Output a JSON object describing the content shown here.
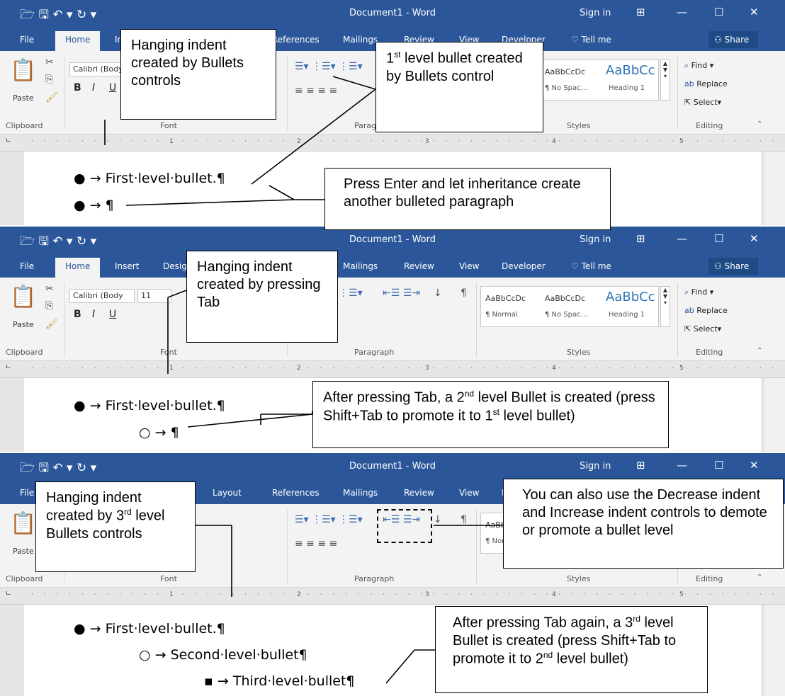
{
  "app": {
    "title": "Document1 - Word",
    "sign_in": "Sign in",
    "win_minimize": "—",
    "win_maximize": "☐",
    "win_close": "✕",
    "qat_glyphs": "🗁 🖫 ↶ ▾ ↻ ▾",
    "tabs": [
      {
        "label": "File"
      },
      {
        "label": "Home"
      },
      {
        "label": "Insert"
      },
      {
        "label": "Design"
      },
      {
        "label": "Layout"
      },
      {
        "label": "References"
      },
      {
        "label": "Mailings"
      },
      {
        "label": "Review"
      },
      {
        "label": "View"
      },
      {
        "label": "Developer"
      }
    ],
    "tell_me": "Tell me",
    "share": "Share"
  },
  "ribbon": {
    "font_name": "Calibri (Body",
    "font_size": "11",
    "bold": "B",
    "italic": "I",
    "underline": "U",
    "paste": "Paste",
    "styles": [
      "AaBbCcDc",
      "AaBbCcDc",
      "AaBbCc"
    ],
    "style_names": [
      "¶ Normal",
      "¶ No Spac...",
      "Heading 1"
    ],
    "find": "Find",
    "replace": "Replace",
    "select": "Select",
    "groups": [
      "Clipboard",
      "Font",
      "Paragraph",
      "Styles",
      "Editing"
    ],
    "ruler_numbers": [
      "1",
      "2",
      "3",
      "4",
      "5"
    ]
  },
  "panel1": {
    "bullets": [
      "First·level·bullet.¶",
      "¶"
    ],
    "callout_indent": "Hanging indent created by Bullets controls",
    "callout_bullet_sup": "st",
    "callout_bullet_a": "1",
    "callout_bullet_b": " level bullet created by Bullets control",
    "callout_enter": "Press Enter and let inheritance create another bulleted paragraph"
  },
  "panel2": {
    "bullets": [
      "First·level·bullet.¶",
      "¶"
    ],
    "callout_indent": "Hanging indent created by pressing Tab",
    "callout_tab_a": "After pressing Tab, a 2",
    "callout_tab_sup1": "nd",
    "callout_tab_b": " level Bullet is created (press Shift+Tab to promote it to 1",
    "callout_tab_sup2": "st",
    "callout_tab_c": " level bullet)"
  },
  "panel3": {
    "bullets": [
      "First·level·bullet.¶",
      "Second·level·bullet¶",
      "Third·level·bullet¶"
    ],
    "callout_indent_a": "Hanging indent created by 3",
    "callout_indent_sup": "rd",
    "callout_indent_b": " level Bullets controls",
    "callout_decrease": "You can also use the Decrease indent and Increase indent controls to demote or promote a bullet level",
    "callout_tab_a": "After pressing Tab again, a 3",
    "callout_tab_sup1": "rd",
    "callout_tab_b": " level Bullet is created (press Shift+Tab to promote it to 2",
    "callout_tab_sup2": "nd",
    "callout_tab_c": " level bullet)"
  },
  "colors": {
    "word_blue": "#2b579a",
    "ribbon_bg": "#f3f3f3",
    "doc_bg": "#e6e6e6"
  }
}
